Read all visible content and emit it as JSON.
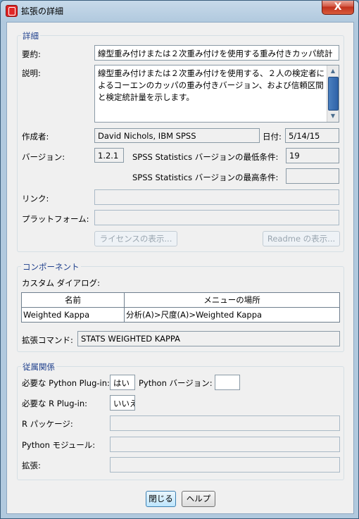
{
  "window": {
    "title": "拡張の詳細",
    "close": "X"
  },
  "details": {
    "legend": "詳細",
    "summary_label": "要約:",
    "summary_value": "線型重み付けまたは２次重み付けを使用する重み付きカッパ統計",
    "description_label": "説明:",
    "description_value": "線型重み付けまたは２次重み付けを使用する、２人の検定者によるコーエンのカッパの重み付きバージョン、および信頼区間と検定統計量を示します。",
    "author_label": "作成者:",
    "author_value": "David Nichols, IBM SPSS",
    "date_label": "日付:",
    "date_value": "5/14/15",
    "version_label": "バージョン:",
    "version_value": "1.2.1",
    "min_label": "SPSS Statistics バージョンの最低条件:",
    "min_value": "19",
    "max_label": "SPSS Statistics バージョンの最高条件:",
    "max_value": "",
    "link_label": "リンク:",
    "link_value": "",
    "platform_label": "プラットフォーム:",
    "platform_value": "",
    "license_button": "ライセンスの表示...",
    "readme_button": "Readme の表示..."
  },
  "components": {
    "legend": "コンポーネント",
    "custom_dialog_label": "カスタム ダイアログ:",
    "columns": [
      "名前",
      "メニューの場所"
    ],
    "rows": [
      {
        "name": "Weighted Kappa",
        "location": "分析(A)>尺度(A)>Weighted Kappa"
      }
    ],
    "ext_command_label": "拡張コマンド:",
    "ext_command_value": "STATS WEIGHTED KAPPA"
  },
  "dependencies": {
    "legend": "従属関係",
    "python_plugin_label": "必要な Python Plug-in:",
    "python_plugin_value": "はい",
    "python_version_label": "Python バージョン:",
    "python_version_value": "",
    "r_plugin_label": "必要な R Plug-in:",
    "r_plugin_value": "いいえ",
    "r_packages_label": "R パッケージ:",
    "r_packages_value": "",
    "python_modules_label": "Python モジュール:",
    "python_modules_value": "",
    "extensions_label": "拡張:",
    "extensions_value": ""
  },
  "buttons": {
    "close": "閉じる",
    "help": "ヘルプ"
  },
  "icons": {
    "app": "spss-app-icon",
    "scroll_up": "scroll-up-icon",
    "scroll_down": "scroll-down-icon"
  }
}
